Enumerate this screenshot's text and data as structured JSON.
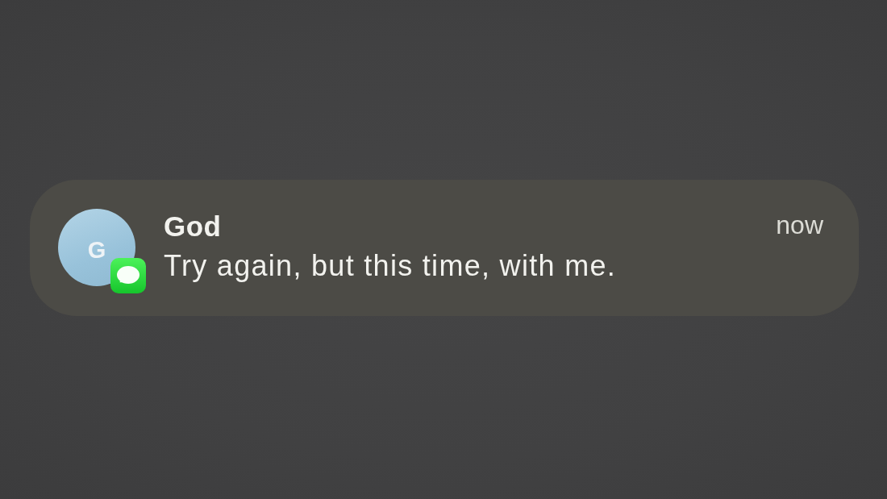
{
  "notification": {
    "avatar": {
      "initial": "G"
    },
    "title": "God",
    "message": "Try again, but this time, with me.",
    "time": "now"
  }
}
